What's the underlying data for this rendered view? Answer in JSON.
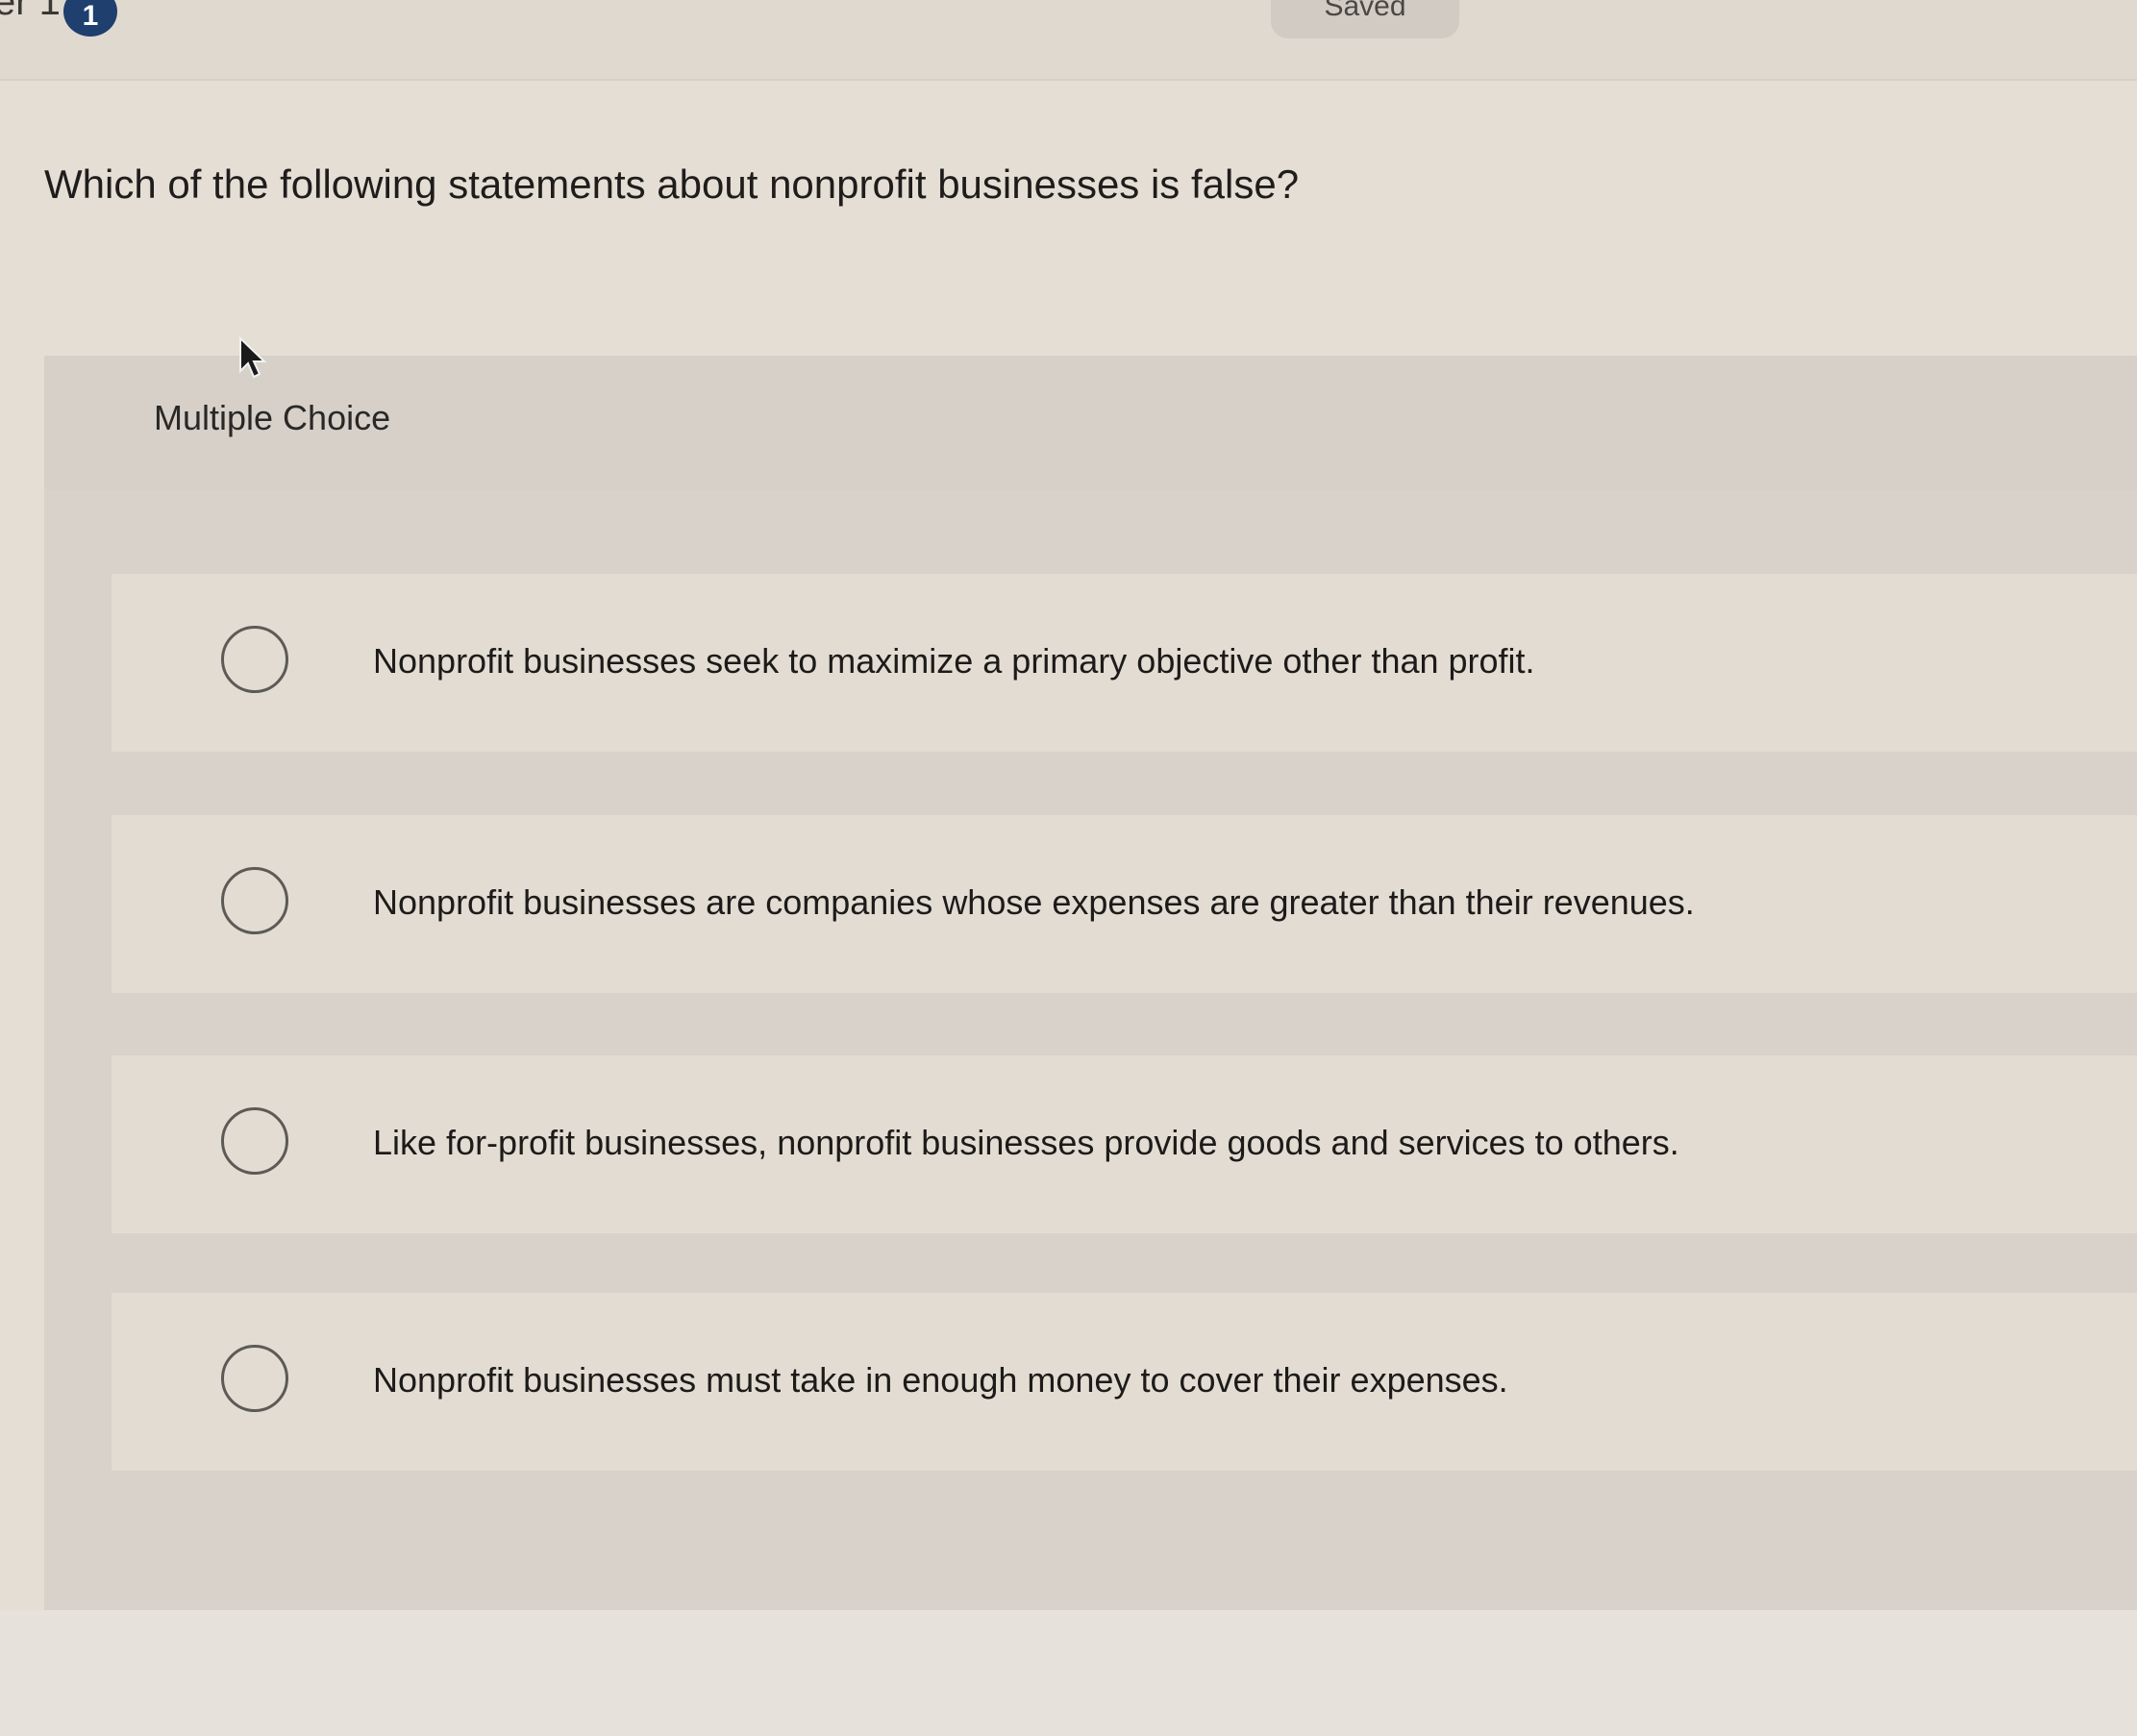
{
  "header": {
    "left_text": "er 1",
    "badge_number": "1",
    "saved_label": "Saved"
  },
  "question": {
    "text": "Which of the following statements about nonprofit businesses is false?"
  },
  "answer_block": {
    "type_label": "Multiple Choice",
    "options": [
      {
        "label": "Nonprofit businesses seek to maximize a primary objective other than profit.",
        "selected": false
      },
      {
        "label": "Nonprofit businesses are companies whose expenses are greater than their revenues.",
        "selected": false
      },
      {
        "label": "Like for-profit businesses, nonprofit businesses provide goods and services to others.",
        "selected": false
      },
      {
        "label": "Nonprofit businesses must take in enough money to cover their expenses.",
        "selected": false
      }
    ]
  },
  "colors": {
    "badge": "#1f3f6e",
    "page_background": "#e4ded5",
    "card_background": "#d8d2ca",
    "option_background": "#e2dcd3"
  },
  "icons": {
    "cursor": "mouse-pointer-icon",
    "radio": "radio-circle-icon"
  }
}
